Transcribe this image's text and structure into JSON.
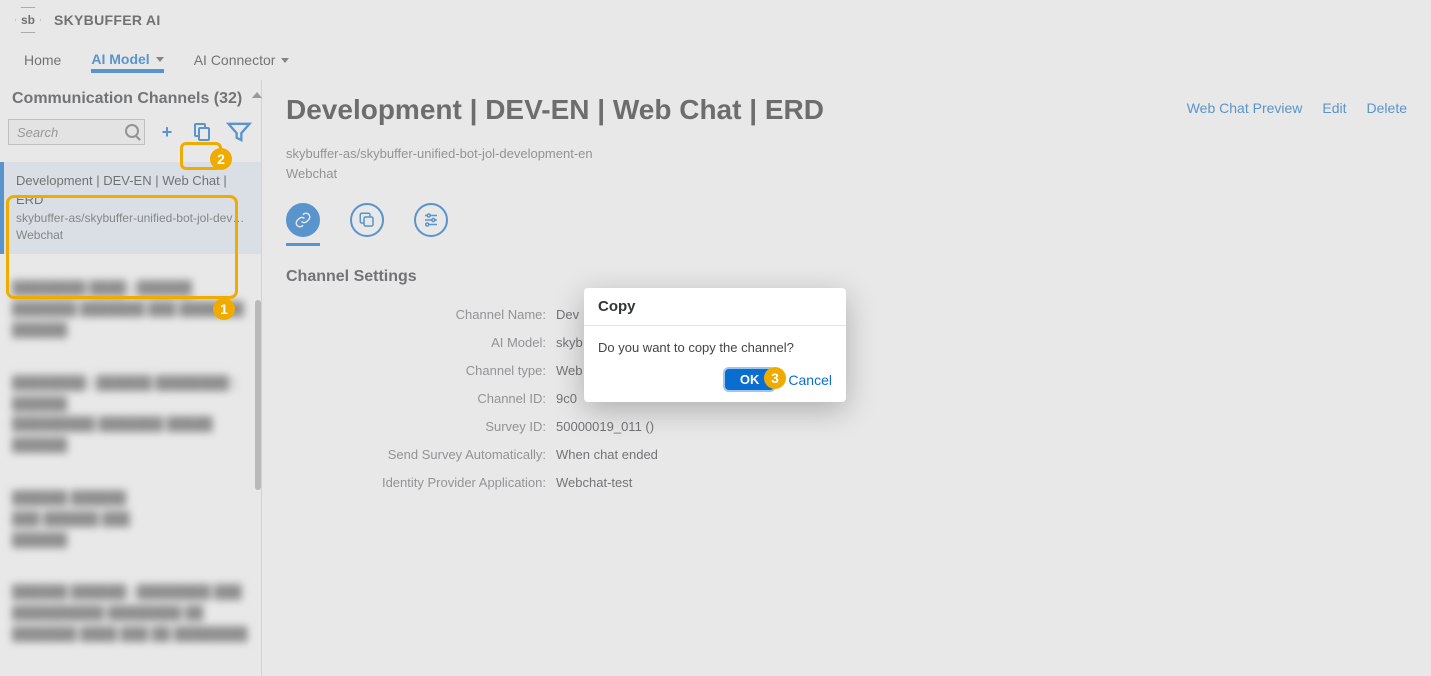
{
  "app": {
    "name": "SKYBUFFER AI",
    "logo_text": "sb"
  },
  "nav": {
    "home": "Home",
    "ai_model": "AI Model",
    "ai_connector": "AI Connector"
  },
  "sidebar": {
    "title": "Communication Channels (32)",
    "search_placeholder": "Search",
    "selected": {
      "title": "Development | DEV-EN | Web Chat | ERD",
      "sub": "skybuffer-as/skybuffer-unified-bot-jol-dev…",
      "type": "Webchat"
    }
  },
  "detail": {
    "title": "Development | DEV-EN | Web Chat | ERD",
    "path_line": "skybuffer-as/skybuffer-unified-bot-jol-development-en",
    "type_line": "Webchat",
    "actions": {
      "preview": "Web Chat Preview",
      "edit": "Edit",
      "delete": "Delete"
    },
    "section": "Channel Settings",
    "fields": {
      "channel_name_k": "Channel Name:",
      "channel_name_v": "Dev",
      "ai_model_k": "AI Model:",
      "ai_model_v": "skyb",
      "channel_type_k": "Channel type:",
      "channel_type_v": "Web",
      "channel_id_k": "Channel ID:",
      "channel_id_v": "9c0",
      "survey_id_k": "Survey ID:",
      "survey_id_v": "50000019_011 ()",
      "send_survey_k": "Send Survey Automatically:",
      "send_survey_v": "When chat ended",
      "idp_k": "Identity Provider Application:",
      "idp_v": "Webchat-test"
    }
  },
  "modal": {
    "title": "Copy",
    "message": "Do you want to copy the channel?",
    "ok": "OK",
    "cancel": "Cancel"
  },
  "callouts": {
    "c1": "1",
    "c2": "2",
    "c3": "3"
  }
}
